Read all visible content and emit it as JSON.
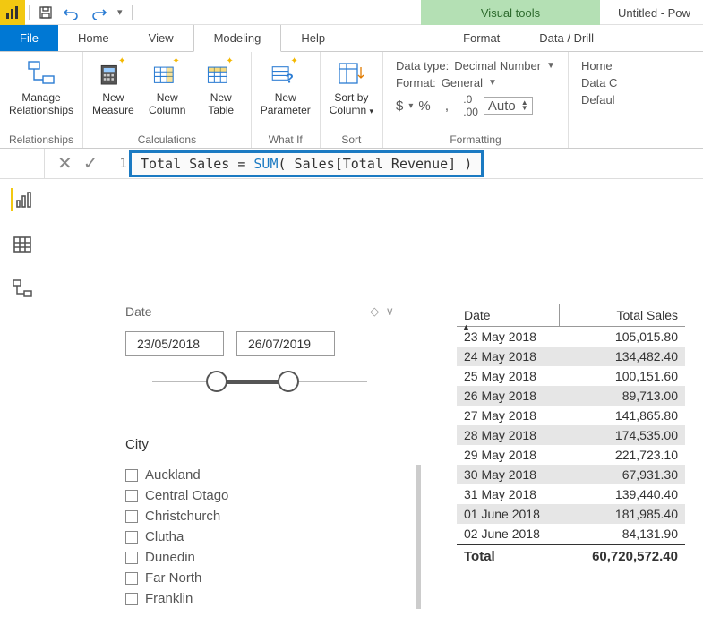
{
  "window": {
    "title": "Untitled - Pow",
    "visual_tools": "Visual tools"
  },
  "ribbon": {
    "file": "File",
    "tabs": [
      "Home",
      "View",
      "Modeling",
      "Help",
      "Format",
      "Data / Drill"
    ],
    "active_tab": "Modeling",
    "groups": {
      "relationships": {
        "label": "Relationships",
        "manage": "Manage\nRelationships"
      },
      "calculations": {
        "label": "Calculations",
        "measure": "New\nMeasure",
        "column": "New\nColumn",
        "table": "New\nTable"
      },
      "whatif": {
        "label": "What If",
        "param": "New\nParameter"
      },
      "sort": {
        "label": "Sort",
        "sortby": "Sort by\nColumn"
      },
      "formatting": {
        "label": "Formatting",
        "datatype_lbl": "Data type:",
        "datatype_val": "Decimal Number",
        "format_lbl": "Format:",
        "format_val": "General",
        "currency": "$",
        "percent": "%",
        "thousand": ",",
        "decimal_btn": ".00",
        "places": "Auto"
      },
      "props": {
        "home": "Home",
        "datacat": "Data C",
        "default": "Defaul"
      }
    }
  },
  "formula": {
    "line_no": "1",
    "text_pre": "Total Sales = ",
    "fn": "SUM",
    "text_post": "( Sales[Total Revenue] )"
  },
  "canvas": {
    "date_slicer": {
      "title": "Date",
      "from": "23/05/2018",
      "to": "26/07/2019"
    },
    "city_slicer": {
      "title": "City",
      "items": [
        "Auckland",
        "Central Otago",
        "Christchurch",
        "Clutha",
        "Dunedin",
        "Far North",
        "Franklin"
      ]
    },
    "table": {
      "col_date": "Date",
      "col_sales": "Total Sales",
      "rows": [
        {
          "d": "23 May 2018",
          "v": "105,015.80"
        },
        {
          "d": "24 May 2018",
          "v": "134,482.40"
        },
        {
          "d": "25 May 2018",
          "v": "100,151.60"
        },
        {
          "d": "26 May 2018",
          "v": "89,713.00"
        },
        {
          "d": "27 May 2018",
          "v": "141,865.80"
        },
        {
          "d": "28 May 2018",
          "v": "174,535.00"
        },
        {
          "d": "29 May 2018",
          "v": "221,723.10"
        },
        {
          "d": "30 May 2018",
          "v": "67,931.30"
        },
        {
          "d": "31 May 2018",
          "v": "139,440.40"
        },
        {
          "d": "01 June 2018",
          "v": "181,985.40"
        },
        {
          "d": "02 June 2018",
          "v": "84,131.90"
        }
      ],
      "total_lbl": "Total",
      "total_val": "60,720,572.40"
    }
  }
}
